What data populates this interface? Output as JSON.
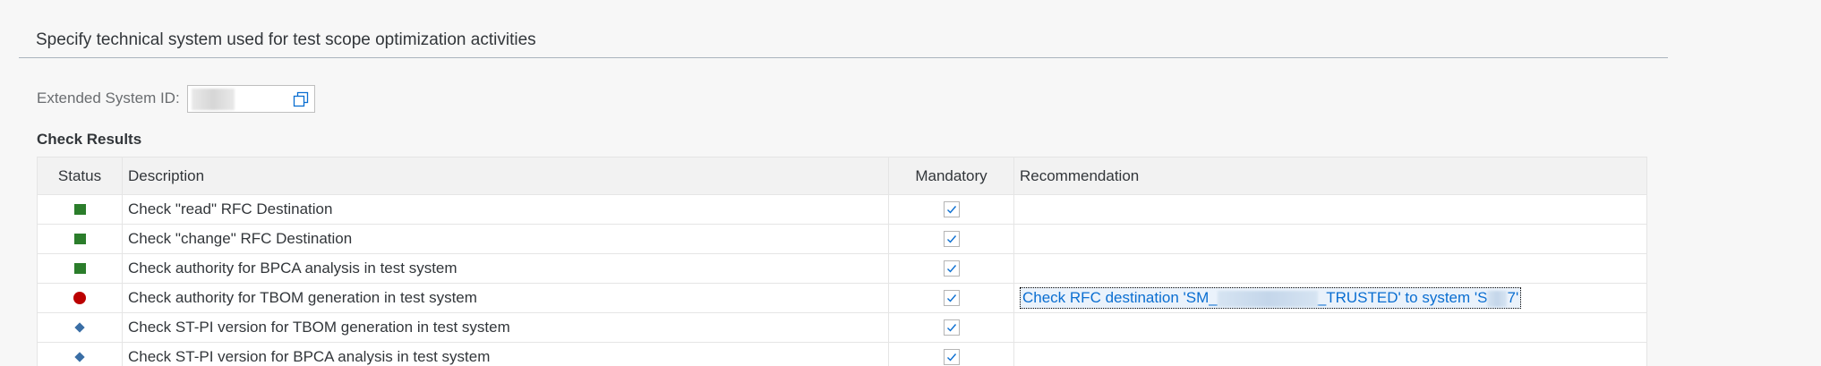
{
  "panel": {
    "title": "Specify technical system used for test scope optimization activities"
  },
  "extended_system": {
    "label": "Extended System ID:",
    "value": "",
    "value_help_icon": "value-help-icon"
  },
  "check_results": {
    "title": "Check Results",
    "columns": [
      "Status",
      "Description",
      "Mandatory",
      "Recommendation"
    ],
    "rows": [
      {
        "status": "success",
        "status_color": "#2b7d2b",
        "description": "Check \"read\" RFC Destination",
        "mandatory": true,
        "recommendation": ""
      },
      {
        "status": "success",
        "status_color": "#2b7d2b",
        "description": "Check \"change\" RFC Destination",
        "mandatory": true,
        "recommendation": ""
      },
      {
        "status": "success",
        "status_color": "#2b7d2b",
        "description": "Check authority for BPCA analysis in test system",
        "mandatory": true,
        "recommendation": ""
      },
      {
        "status": "error",
        "status_color": "#bb0000",
        "description": "Check authority for TBOM generation in test system",
        "mandatory": true,
        "recommendation_parts": [
          "Check RFC destination 'SM_",
          "_TRUSTED' to system 'S",
          "7'"
        ]
      },
      {
        "status": "info",
        "status_color": "#3a6ea5",
        "description": "Check ST-PI version for TBOM generation in test system",
        "mandatory": true,
        "recommendation": ""
      },
      {
        "status": "info",
        "status_color": "#3a6ea5",
        "description": "Check ST-PI version for BPCA analysis in test system",
        "mandatory": true,
        "recommendation": ""
      }
    ]
  },
  "colors": {
    "link": "#0a6ed1",
    "success": "#2b7d2b",
    "error": "#bb0000",
    "info": "#3a6ea5"
  }
}
